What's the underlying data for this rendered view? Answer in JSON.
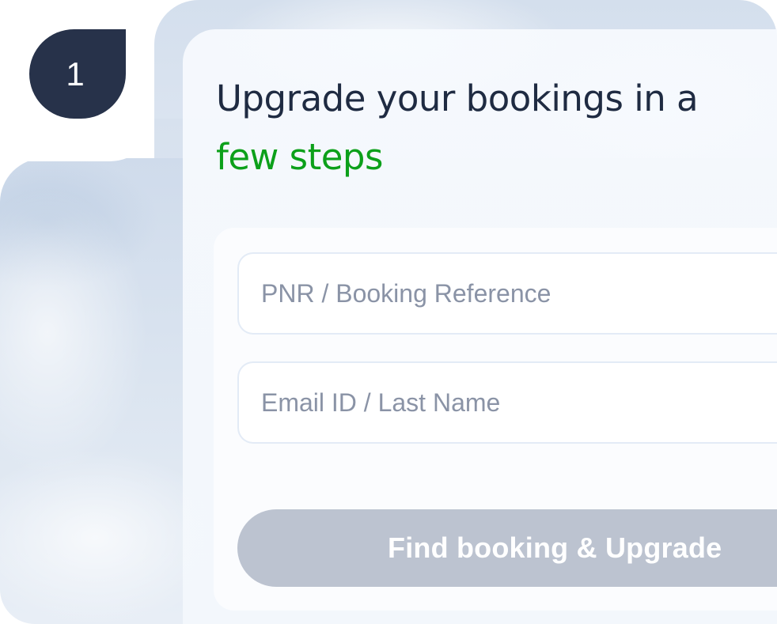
{
  "step": {
    "number": "1"
  },
  "heading": {
    "line1": "Upgrade your bookings in a",
    "line2": "few steps"
  },
  "form": {
    "pnr_placeholder": "PNR / Booking Reference",
    "email_placeholder": "Email ID / Last Name",
    "submit_label": "Find booking & Upgrade"
  },
  "colors": {
    "badge": "#27324a",
    "heading": "#1f2b42",
    "accent": "#0ca01a",
    "button_disabled": "#bcc3d0"
  }
}
